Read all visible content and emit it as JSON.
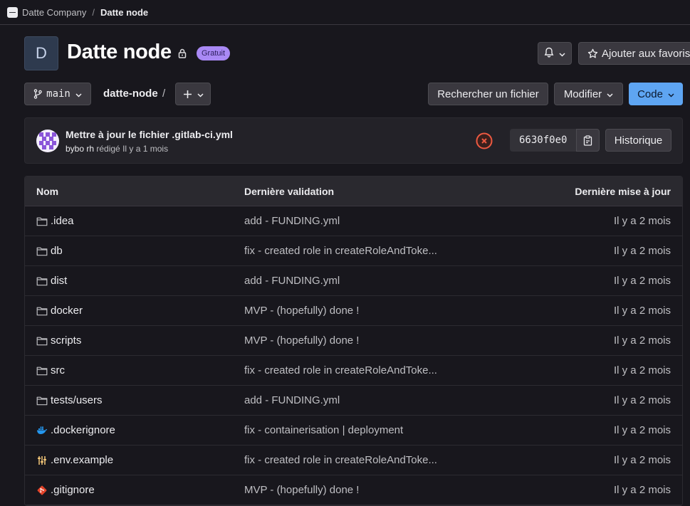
{
  "breadcrumb": {
    "group": "Datte Company",
    "separator": "/",
    "project": "Datte node"
  },
  "project": {
    "avatar_letter": "D",
    "title": "Datte node",
    "badge": "Gratuit"
  },
  "header_actions": {
    "notifications_icon": "bell-icon",
    "favorite_label": "Ajouter aux favoris"
  },
  "toolbar": {
    "branch": "main",
    "path": "datte-node",
    "path_separator": "/",
    "add_icon": "plus-icon",
    "find_file": "Rechercher un fichier",
    "edit": "Modifier",
    "code": "Code"
  },
  "last_commit": {
    "title": "Mettre à jour le fichier .gitlab-ci.yml",
    "author": "bybo rh",
    "meta": "rédigé Il y a 1 mois",
    "status": "failed",
    "sha": "6630f0e0",
    "history": "Historique"
  },
  "table": {
    "headers": {
      "name": "Nom",
      "commit": "Dernière validation",
      "date": "Dernière mise à jour"
    },
    "rows": [
      {
        "name": ".idea",
        "icon": "folder-icon",
        "commit": "add - FUNDING.yml",
        "date": "Il y a 2 mois"
      },
      {
        "name": "db",
        "icon": "folder-icon",
        "commit": "fix - created role in createRoleAndToke...",
        "date": "Il y a 2 mois"
      },
      {
        "name": "dist",
        "icon": "folder-icon",
        "commit": "add - FUNDING.yml",
        "date": "Il y a 2 mois"
      },
      {
        "name": "docker",
        "icon": "folder-icon",
        "commit": "MVP - (hopefully) done !",
        "date": "Il y a 2 mois"
      },
      {
        "name": "scripts",
        "icon": "folder-icon",
        "commit": "MVP - (hopefully) done !",
        "date": "Il y a 2 mois"
      },
      {
        "name": "src",
        "icon": "folder-icon",
        "commit": "fix - created role in createRoleAndToke...",
        "date": "Il y a 2 mois"
      },
      {
        "name": "tests/users",
        "icon": "folder-icon",
        "commit": "add - FUNDING.yml",
        "date": "Il y a 2 mois"
      },
      {
        "name": ".dockerignore",
        "icon": "docker-icon",
        "commit": "fix - containerisation | deployment",
        "date": "Il y a 2 mois"
      },
      {
        "name": ".env.example",
        "icon": "settings-sliders-icon",
        "commit": "fix - created role in createRoleAndToke...",
        "date": "Il y a 2 mois"
      },
      {
        "name": ".gitignore",
        "icon": "git-icon",
        "commit": "MVP - (hopefully) done !",
        "date": "Il y a 2 mois"
      }
    ]
  },
  "colors": {
    "background": "#18171d",
    "primary_button": "#5ea5f2",
    "badge": "#a989f5",
    "failed_status": "#ec5941"
  }
}
